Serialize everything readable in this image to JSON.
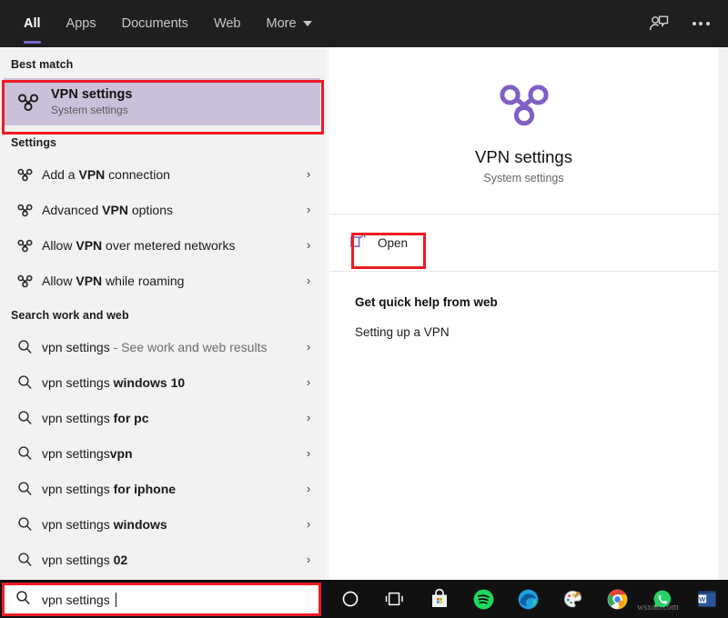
{
  "header": {
    "tabs": [
      {
        "label": "All",
        "active": true,
        "caret": false
      },
      {
        "label": "Apps",
        "active": false,
        "caret": false
      },
      {
        "label": "Documents",
        "active": false,
        "caret": false
      },
      {
        "label": "Web",
        "active": false,
        "caret": false
      },
      {
        "label": "More",
        "active": false,
        "caret": true
      }
    ],
    "feedback_icon": "person-feedback-icon",
    "more_icon": "ellipsis-icon"
  },
  "left": {
    "best_match_heading": "Best match",
    "best_match": {
      "title": "VPN settings",
      "subtitle": "System settings",
      "icon": "vpn-knot-icon",
      "highlight_color": "#cbc0da"
    },
    "settings_heading": "Settings",
    "settings_items": [
      {
        "prefix": "Add a ",
        "bold": "VPN",
        "suffix": " connection"
      },
      {
        "prefix": "Advanced ",
        "bold": "VPN",
        "suffix": " options"
      },
      {
        "prefix": "Allow ",
        "bold": "VPN",
        "suffix": " over metered networks"
      },
      {
        "prefix": "Allow ",
        "bold": "VPN",
        "suffix": " while roaming"
      }
    ],
    "web_heading": "Search work and web",
    "web_items": [
      {
        "prefix": "vpn settings",
        "bold": "",
        "muted": " - See work and web results"
      },
      {
        "prefix": "vpn settings ",
        "bold": "windows 10",
        "muted": ""
      },
      {
        "prefix": "vpn settings ",
        "bold": "for pc",
        "muted": ""
      },
      {
        "prefix": "vpn settings",
        "bold": "vpn",
        "muted": ""
      },
      {
        "prefix": "vpn settings ",
        "bold": "for iphone",
        "muted": ""
      },
      {
        "prefix": "vpn settings ",
        "bold": "windows",
        "muted": ""
      },
      {
        "prefix": "vpn settings ",
        "bold": "02",
        "muted": ""
      }
    ],
    "chevron": "›"
  },
  "right": {
    "app_icon": "vpn-knot-icon",
    "title": "VPN settings",
    "subtitle": "System settings",
    "open_label": "Open",
    "open_icon": "open-external-icon",
    "help_title": "Get quick help from web",
    "help_link": "Setting up a VPN"
  },
  "taskbar": {
    "search_value": "vpn settings",
    "search_icon": "search-icon",
    "items": [
      {
        "name": "cortana-icon",
        "label": "Cortana"
      },
      {
        "name": "task-view-icon",
        "label": "Task View"
      },
      {
        "name": "microsoft-store-icon",
        "label": "Microsoft Store"
      },
      {
        "name": "spotify-icon",
        "label": "Spotify"
      },
      {
        "name": "microsoft-edge-icon",
        "label": "Microsoft Edge"
      },
      {
        "name": "paint-icon",
        "label": "Paint"
      },
      {
        "name": "google-chrome-icon",
        "label": "Google Chrome"
      },
      {
        "name": "whatsapp-icon",
        "label": "WhatsApp"
      },
      {
        "name": "microsoft-word-icon",
        "label": "Word"
      }
    ],
    "watermark": "wsxdn.com"
  },
  "colors": {
    "accent_purple": "#7f66c4",
    "annotation_red": "#ee1b24",
    "header_bg": "#1f1f1f",
    "left_bg": "#f2f2f2"
  }
}
